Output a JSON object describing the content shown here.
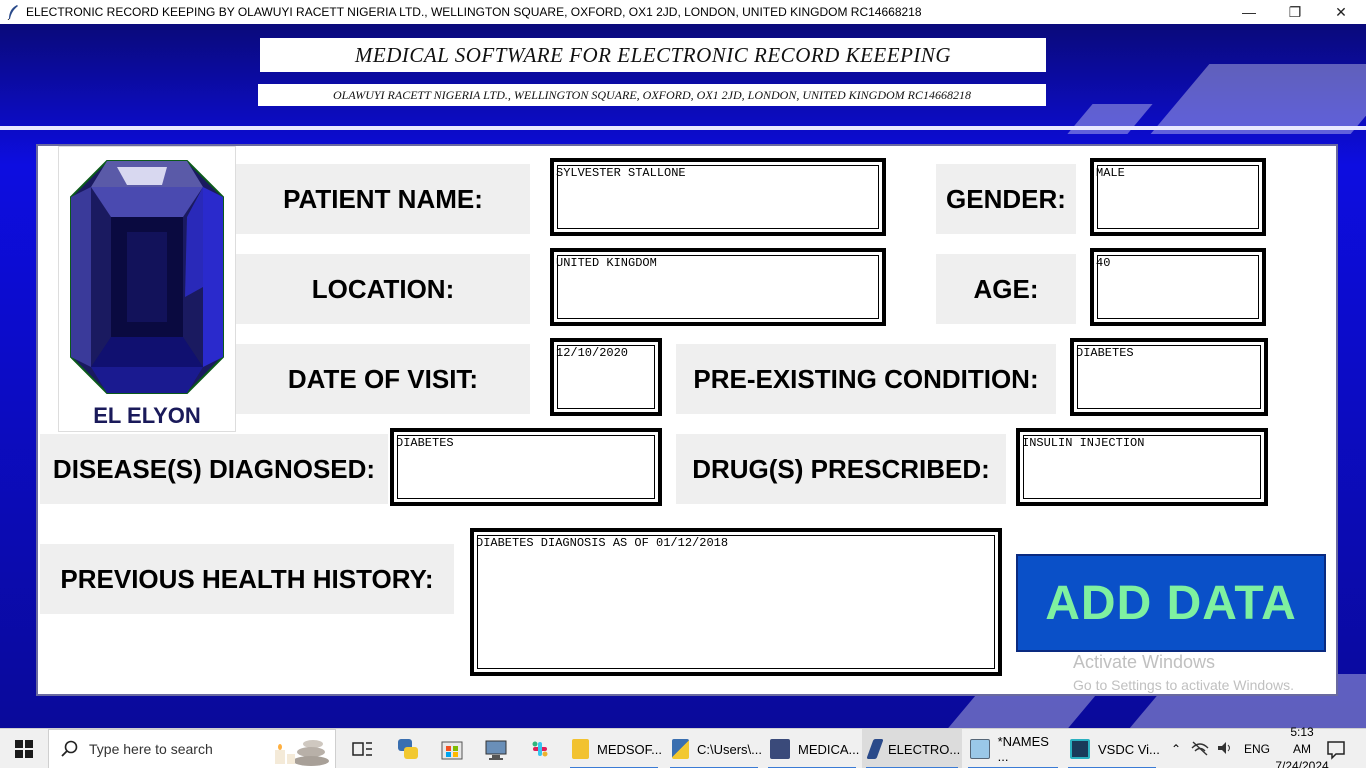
{
  "window": {
    "title": "ELECTRONIC RECORD KEEPING BY OLAWUYI RACETT NIGERIA LTD., WELLINGTON SQUARE, OXFORD, OX1 2JD, LONDON, UNITED KINGDOM RC14668218",
    "minimize": "—",
    "maximize": "❐",
    "close": "✕"
  },
  "header": {
    "title": "MEDICAL SOFTWARE FOR ELECTRONIC RECORD KEEEPING",
    "subtitle": "OLAWUYI RACETT NIGERIA LTD., WELLINGTON SQUARE, OXFORD, OX1 2JD, LONDON, UNITED KINGDOM RC14668218"
  },
  "logo": {
    "caption": "EL ELYON",
    "icon": "sapphire-gem"
  },
  "labels": {
    "patient_name": "PATIENT  NAME:",
    "gender": "GENDER:",
    "location": "LOCATION:",
    "age": "AGE:",
    "date_of_visit": "DATE OF VISIT:",
    "pre_existing": "PRE-EXISTING CONDITION:",
    "diseases": "DISEASE(S) DIAGNOSED:",
    "drugs": "DRUG(S) PRESCRIBED:",
    "history": "PREVIOUS HEALTH HISTORY:"
  },
  "fields": {
    "patient_name": "SYLVESTER STALLONE",
    "gender": "MALE",
    "location": "UNITED KINGDOM",
    "age": "40",
    "date_of_visit": "12/10/2020",
    "pre_existing": "DIABETES",
    "diseases": "DIABETES",
    "drugs": "INSULIN INJECTION",
    "history": "DIABETES DIAGNOSIS AS OF 01/12/2018"
  },
  "add_button": "ADD DATA",
  "watermark": {
    "line1": "Activate Windows",
    "line2": "Go to Settings to activate Windows."
  },
  "taskbar": {
    "search_placeholder": "Type here to search",
    "items": [
      {
        "label": "MEDSOF...",
        "icon": "folder-icon"
      },
      {
        "label": "C:\\Users\\...",
        "icon": "python-file-icon"
      },
      {
        "label": "MEDICA...",
        "icon": "image-viewer-icon"
      },
      {
        "label": "ELECTRO...",
        "icon": "python-feather-icon"
      },
      {
        "label": "*NAMES ...",
        "icon": "notepad-icon"
      },
      {
        "label": "VSDC Vi...",
        "icon": "vsdc-icon"
      }
    ],
    "language": "ENG",
    "time": "5:13 AM",
    "date": "7/24/2024"
  },
  "colors": {
    "background_blue": "#0d0de0",
    "button_blue": "#0a50c8",
    "button_text": "#7ff0a0",
    "label_bg": "#efefef"
  }
}
